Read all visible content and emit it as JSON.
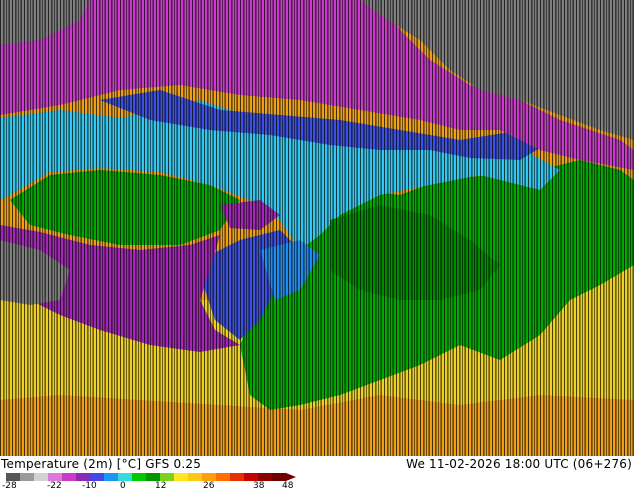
{
  "map": {
    "product_title": "Temperature (2m) [°C] GFS 0.25",
    "valid_time": "We 11-02-2026 18:00 UTC (06+276)",
    "palette": {
      "deep_cold": "#7e7e7e",
      "very_cold": "#c83cc8",
      "cold_magenta": "#a028b4",
      "cold_blue": "#3c50dc",
      "cool_cyan": "#1e8cf0",
      "cool_light": "#32c8f0",
      "mild_green": "#00aa00",
      "mild_green_dark": "#008c00",
      "warm_yellow": "#f0d21e",
      "warm_orange": "#f0a014",
      "contour": "#000000"
    }
  },
  "legend": {
    "ticks": [
      "-28",
      "-22",
      "-10",
      "0",
      "12",
      "26",
      "38",
      "48"
    ],
    "colors": [
      "#555555",
      "#9a9a9a",
      "#d2d2d2",
      "#dc78dc",
      "#c83cc8",
      "#8c28b4",
      "#4646e6",
      "#1e96f0",
      "#32dcdc",
      "#00c800",
      "#009600",
      "#78d21e",
      "#ffe61e",
      "#ffc814",
      "#ffa00a",
      "#ff6e00",
      "#e63200",
      "#c80000",
      "#8c0000",
      "#6e0000"
    ]
  }
}
